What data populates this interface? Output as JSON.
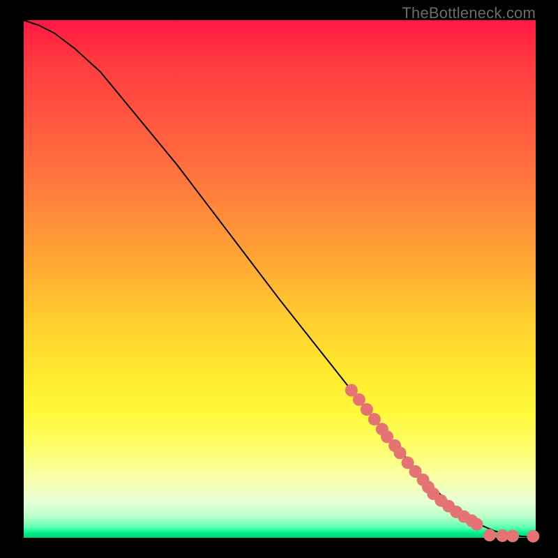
{
  "watermark": "TheBottleneck.com",
  "colors": {
    "dot_fill": "#e57373",
    "curve_stroke": "#000000"
  },
  "chart_data": {
    "type": "line",
    "title": "",
    "xlabel": "",
    "ylabel": "",
    "xlim": [
      0,
      100
    ],
    "ylim": [
      0,
      100
    ],
    "grid": false,
    "legend": false,
    "annotations": [
      "TheBottleneck.com"
    ],
    "series": [
      {
        "name": "curve",
        "kind": "line",
        "x": [
          0,
          3,
          6,
          10,
          15,
          20,
          30,
          40,
          50,
          60,
          70,
          78,
          84,
          88,
          92,
          95,
          97,
          99,
          100
        ],
        "y": [
          100,
          99,
          97.5,
          94.5,
          90,
          84,
          72,
          59,
          46,
          33.5,
          21,
          11.5,
          6,
          3,
          1.3,
          0.6,
          0.3,
          0.15,
          0.1
        ]
      },
      {
        "name": "dots",
        "kind": "scatter",
        "x": [
          64,
          65.5,
          67,
          68.5,
          70,
          71,
          72.5,
          73.5,
          75,
          76.5,
          78,
          79,
          80,
          81.5,
          83,
          84.5,
          86,
          87.5,
          88.5,
          91,
          93.5,
          95.5,
          99.5
        ],
        "y": [
          28.5,
          26.7,
          24.8,
          22.9,
          21,
          19.5,
          17.8,
          16.4,
          14.5,
          12.8,
          11.2,
          9.8,
          8.5,
          7.2,
          6.1,
          5,
          4.1,
          3.3,
          2.6,
          0.5,
          0.4,
          0.35,
          0.3
        ]
      }
    ]
  }
}
